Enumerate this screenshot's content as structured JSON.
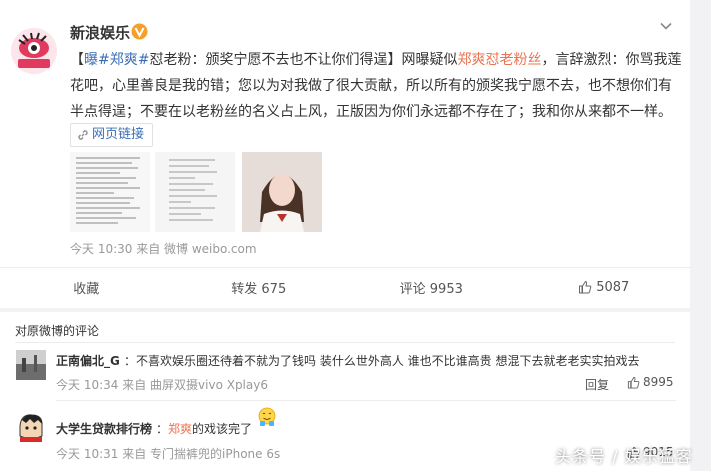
{
  "post": {
    "username": "新浪娱乐",
    "text_parts": {
      "bracket_open": "【",
      "hashtag": "曝#郑爽#",
      "headline": "怼老粉：颁奖宁愿不去也不让你们得逞】网曝疑似",
      "link_name": "郑爽怼老粉丝",
      "body": "，言辞激烈：你骂我莲花吧，心里善良是我的错；您以为对我做了很大贡献，所以所有的颁奖我宁愿不去，也不想你们有半点得逞；不要在以老粉丝的名义占上风，正版因为你们永远都不存在了；我和你从来都不一样。"
    },
    "weblink_label": "网页链接",
    "meta": "今天 10:30 来自 微博 weibo.com"
  },
  "actions": {
    "favorite": "收藏",
    "repost": "转发 675",
    "comment": "评论 9953",
    "like": "5087"
  },
  "comments": {
    "title": "对原微博的评论",
    "items": [
      {
        "name": "正南偏北_G",
        "sep": "：",
        "text": "不喜欢娱乐圈还待着不就为了钱吗 装什么世外高人 谁也不比谁高贵 想混下去就老老实实拍戏去",
        "meta": "今天 10:34 来自 曲屏双摄vivo Xplay6",
        "reply": "回复",
        "likes": "8995"
      },
      {
        "name": "大学生贷款排行榜",
        "sep": "：",
        "mention": "郑爽",
        "text": "的戏该完了",
        "meta": "今天 10:31 来自 专门揣裤兜的iPhone 6s",
        "likes": "9015"
      }
    ]
  },
  "watermark": "头条号 / 娱乐猛客",
  "colors": {
    "accent": "#eb7350",
    "link": "#3b6fb5",
    "verified": "#f6a02b"
  },
  "icons": [
    "avatar-logo",
    "verified-icon",
    "chevron-down-icon",
    "link-icon",
    "thumbs-up-icon",
    "emoji-icon"
  ]
}
